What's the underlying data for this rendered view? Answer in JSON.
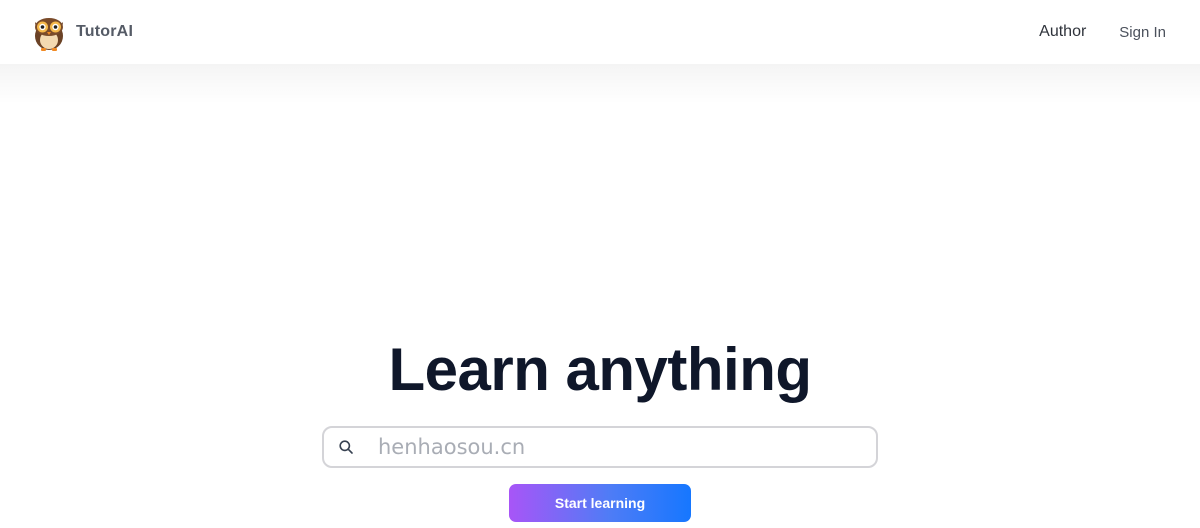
{
  "header": {
    "brand_name": "TutorAI",
    "logo_icon": "owl-icon",
    "nav": {
      "author_label": "Author",
      "signin_label": "Sign In"
    }
  },
  "hero": {
    "title": "Learn anything",
    "search": {
      "icon": "search-icon",
      "placeholder": "henhaosou.cn",
      "value": ""
    },
    "start_button_label": "Start learning"
  },
  "colors": {
    "title": "#0f172a",
    "button_gradient_start": "#a855f7",
    "button_gradient_end": "#1677ff",
    "search_border": "#d4d4d8"
  }
}
